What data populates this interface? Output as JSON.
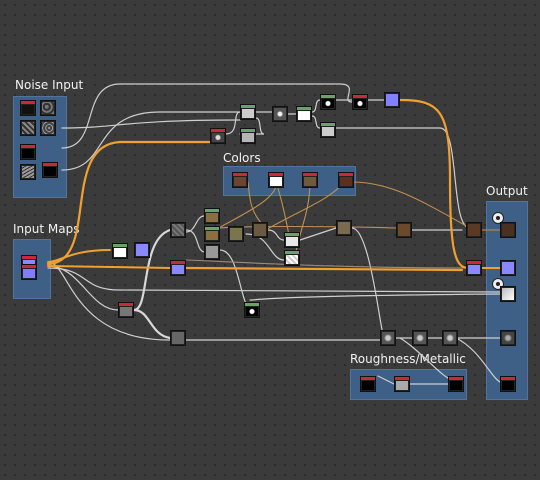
{
  "frames": {
    "noise_input": "Noise Input",
    "input_maps": "Input Maps",
    "colors": "Colors",
    "output": "Output",
    "roughness_metallic": "Roughness/Metallic"
  },
  "colors": {
    "canvas": "#3b3b3b",
    "frame": "#3e5f86",
    "wire_gray": "#cfcfcf",
    "wire_orange": "#f0a030",
    "wire_tan": "#c09050"
  },
  "node_types": [
    "noise",
    "color",
    "blend",
    "normal",
    "grayscale",
    "mask",
    "output"
  ]
}
